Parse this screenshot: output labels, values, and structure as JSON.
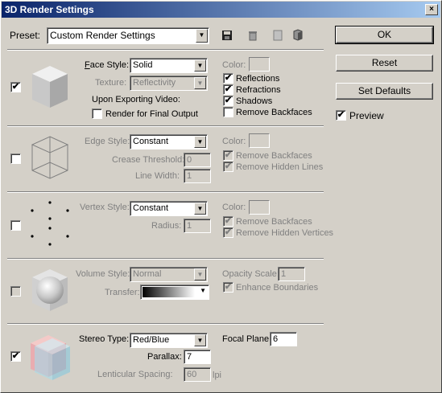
{
  "window": {
    "title": "3D Render Settings",
    "close": "×"
  },
  "preset": {
    "label": "Preset:",
    "value": "Custom Render Settings"
  },
  "toolbar_icons": [
    "save-icon",
    "delete-icon",
    "new-icon",
    "cube-icon"
  ],
  "face": {
    "checked": "✔",
    "style_label": "Face Style:",
    "style_value": "Solid",
    "texture_label": "Texture:",
    "texture_value": "Reflectivity",
    "upon_exporting": "Upon Exporting Video:",
    "render_final": "Render for Final Output",
    "color_label": "Color:",
    "reflections": "Reflections",
    "refractions": "Refractions",
    "shadows": "Shadows",
    "remove_backfaces": "Remove Backfaces",
    "reflections_checked": "✔",
    "refractions_checked": "✔",
    "shadows_checked": "✔"
  },
  "edge": {
    "style_label": "Edge Style:",
    "style_value": "Constant",
    "crease_label": "Crease Threshold:",
    "crease_value": "0",
    "line_width_label": "Line Width:",
    "line_width_value": "1",
    "color_label": "Color:",
    "remove_backfaces": "Remove Backfaces",
    "remove_hidden": "Remove Hidden Lines",
    "rb_checked": "✔",
    "rh_checked": "✔"
  },
  "vertex": {
    "style_label": "Vertex Style:",
    "style_value": "Constant",
    "radius_label": "Radius:",
    "radius_value": "1",
    "color_label": "Color:",
    "remove_backfaces": "Remove Backfaces",
    "remove_hidden": "Remove Hidden Vertices",
    "rb_checked": "✔",
    "rh_checked": "✔"
  },
  "volume": {
    "style_label": "Volume Style:",
    "style_value": "Normal",
    "transfer_label": "Transfer:",
    "opacity_label": "Opacity Scale:",
    "opacity_value": "1",
    "enhance": "Enhance Boundaries",
    "enhance_checked": "✔"
  },
  "stereo": {
    "checked": "✔",
    "type_label": "Stereo Type:",
    "type_value": "Red/Blue",
    "parallax_label": "Parallax:",
    "parallax_value": "7",
    "lenticular_label": "Lenticular Spacing:",
    "lenticular_value": "60",
    "lenticular_unit": "lpi",
    "focal_label": "Focal Plane:",
    "focal_value": "6"
  },
  "buttons": {
    "ok": "OK",
    "reset": "Reset",
    "set_defaults": "Set Defaults"
  },
  "preview": {
    "label": "Preview",
    "checked": "✔"
  }
}
